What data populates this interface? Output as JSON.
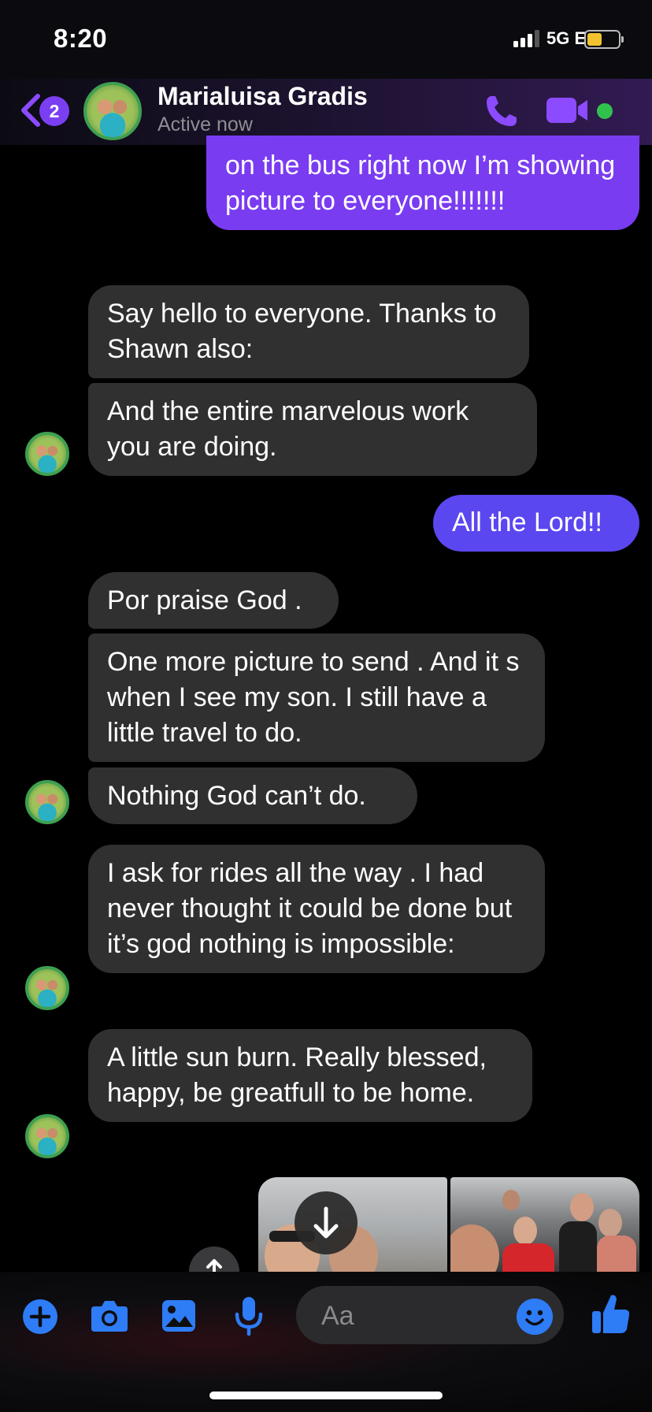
{
  "status_bar": {
    "time": "8:20",
    "network": "5G E"
  },
  "header": {
    "unread_count": "2",
    "contact_name": "Marialuisa Gradis",
    "contact_status": "Active now"
  },
  "messages": [
    {
      "from": "me",
      "text": "on the bus right now I’m showing picture to everyone!!!!!!!"
    },
    {
      "from": "them",
      "text": "Say hello to everyone. Thanks to Shawn also:"
    },
    {
      "from": "them",
      "text": "And the entire marvelous work you are doing."
    },
    {
      "from": "me",
      "text": "All the Lord!!"
    },
    {
      "from": "them",
      "text": "Por praise God ."
    },
    {
      "from": "them",
      "text": "One more picture to send . And it s when I see my son. I still have a little travel to do."
    },
    {
      "from": "them",
      "text": "Nothing God can’t do."
    },
    {
      "from": "them",
      "text": "I ask for rides all the way . I had never thought it could be done but it’s god nothing is impossible:"
    },
    {
      "from": "them",
      "text": "A little sun burn. Really blessed, happy, be greatfull to be home."
    }
  ],
  "composer": {
    "placeholder": "Aa"
  },
  "colors": {
    "accent": "#7a3cf1",
    "accent_indigo": "#5b47f0",
    "incoming_bubble": "#303030",
    "online": "#31c24d",
    "composer_icons": "#2e7cf6"
  }
}
